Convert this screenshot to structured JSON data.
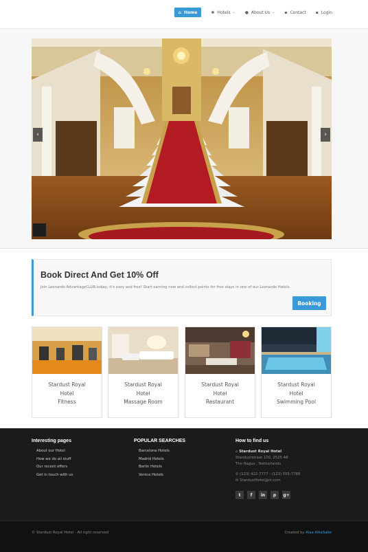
{
  "nav": {
    "items": [
      {
        "label": "Home",
        "icon": "home-icon",
        "glyph": "⌂",
        "active": true
      },
      {
        "label": "Hotels",
        "icon": "gear-icon",
        "glyph": "✱",
        "dropdown": true
      },
      {
        "label": "About Us",
        "icon": "info-icon",
        "glyph": "●",
        "dropdown": true
      },
      {
        "label": "Contact",
        "icon": "user-card-icon",
        "glyph": "▪"
      },
      {
        "label": "Login",
        "icon": "login-icon",
        "glyph": "▪"
      }
    ]
  },
  "promo": {
    "title": "Book Direct And Get 10% Off",
    "text": "Join Leonardo AdvantageCLUB today, it's easy and free! Start earning now and collect points for free stays in one of our Leonardo Hotels.",
    "button": "Booking"
  },
  "cards": [
    {
      "lines": [
        "Stardust Royal",
        "Hotel",
        "Fitness"
      ],
      "image": "gym"
    },
    {
      "lines": [
        "Stardust Royal",
        "Hotel",
        "Massage Room"
      ],
      "image": "massage"
    },
    {
      "lines": [
        "Stardust Royal",
        "Hotel",
        "Restaurant"
      ],
      "image": "restaurant"
    },
    {
      "lines": [
        "Stardust Royal",
        "Hotel",
        "Swimming Pool"
      ],
      "image": "pool"
    }
  ],
  "footer": {
    "col1": {
      "title": "Interesting pages",
      "links": [
        "About our Hotel",
        "How we do all stuff",
        "Our recent offers",
        "Get in touch with us"
      ]
    },
    "col2": {
      "title": "POPULAR SEARCHES",
      "links": [
        "Barcelona Hotels",
        "Madrid Hotels",
        "Berlin Hotels",
        "Venice Hotels"
      ]
    },
    "col3": {
      "title": "How to find us",
      "name": "Stardust Royal Hotel",
      "street": "Standuststraat 100, 2525 AB",
      "city": "The Hague , Netherlands",
      "phone": "(123) 422-7777 - (123) 555-7788",
      "email": "StardustHotel@nl.com",
      "socials": [
        {
          "icon": "twitter-icon",
          "glyph": "t"
        },
        {
          "icon": "facebook-icon",
          "glyph": "f"
        },
        {
          "icon": "linkedin-icon",
          "glyph": "in"
        },
        {
          "icon": "pinterest-icon",
          "glyph": "p"
        },
        {
          "icon": "google-plus-icon",
          "glyph": "g+"
        }
      ]
    },
    "copyright": "© Stardust Royal Hotel - All right reserved",
    "created_by": "Created by",
    "author": "Alaa AlkaSabe"
  },
  "colors": {
    "accent": "#3a9ad9",
    "footer_bg": "#1b1b1b"
  }
}
